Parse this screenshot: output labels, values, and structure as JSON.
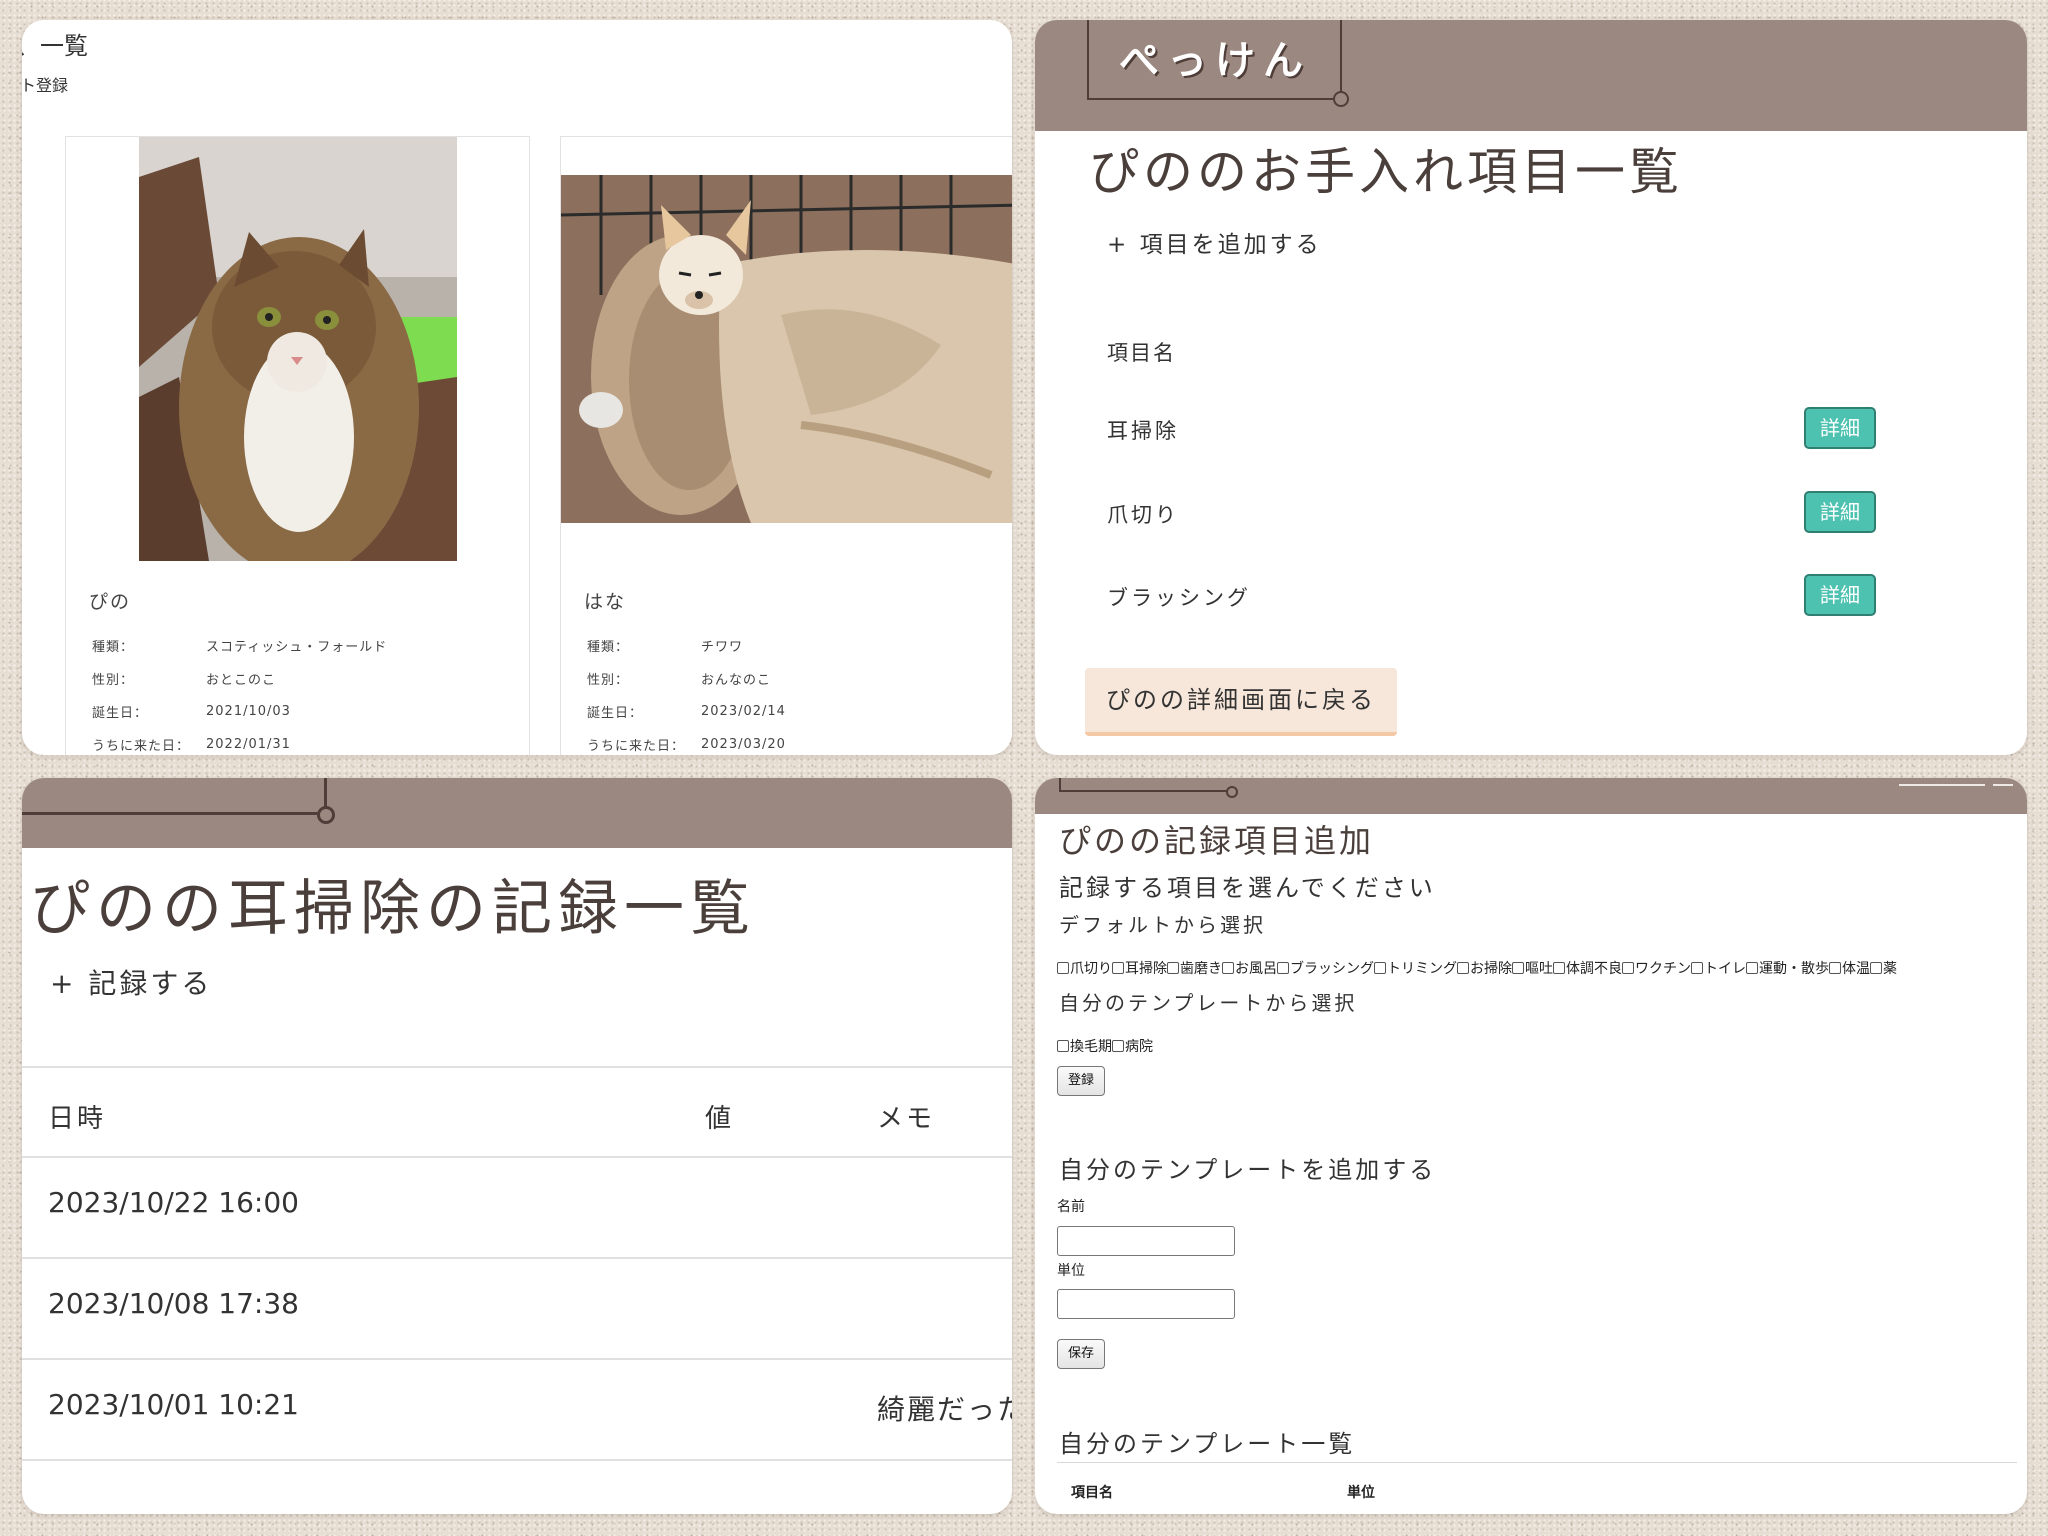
{
  "panel1": {
    "title": "、一覧",
    "register_link": "ト登録",
    "pets": [
      {
        "name": "ぴの",
        "photo": "cat-photo",
        "fields": [
          {
            "label": "種類：",
            "value": "スコティッシュ・フォールド"
          },
          {
            "label": "性別：",
            "value": "おとこのこ"
          },
          {
            "label": "誕生日：",
            "value": "2021/10/03"
          },
          {
            "label": "うちに来た日：",
            "value": "2022/01/31"
          }
        ]
      },
      {
        "name": "はな",
        "photo": "dog-photo",
        "fields": [
          {
            "label": "種類：",
            "value": "チワワ"
          },
          {
            "label": "性別：",
            "value": "おんなのこ"
          },
          {
            "label": "誕生日：",
            "value": "2023/02/14"
          },
          {
            "label": "うちに来た日：",
            "value": "2023/03/20"
          }
        ]
      }
    ]
  },
  "panel2": {
    "logo": "ぺっけん",
    "title": "ぴののお手入れ項目一覧",
    "add_link": "+ 項目を追加する",
    "column_header": "項目名",
    "items": [
      {
        "name": "耳掃除",
        "button": "詳細"
      },
      {
        "name": "爪切り",
        "button": "詳細"
      },
      {
        "name": "ブラッシング",
        "button": "詳細"
      }
    ],
    "back_button": "ぴのの詳細画面に戻る"
  },
  "panel3": {
    "title": "ぴのの耳掃除の記録一覧",
    "add_link": "+ 記録する",
    "columns": {
      "date": "日時",
      "value": "値",
      "memo": "メモ"
    },
    "rows": [
      {
        "date": "2023/10/22 16:00",
        "value": "",
        "memo": ""
      },
      {
        "date": "2023/10/08 17:38",
        "value": "",
        "memo": ""
      },
      {
        "date": "2023/10/01 10:21",
        "value": "",
        "memo": "綺麗だった"
      }
    ]
  },
  "panel4": {
    "title": "ぴのの記録項目追加",
    "choose_heading": "記録する項目を選んでください",
    "default_heading": "デフォルトから選択",
    "default_options": [
      "爪切り",
      "耳掃除",
      "歯磨き",
      "お風呂",
      "ブラッシング",
      "トリミング",
      "お掃除",
      "嘔吐",
      "体調不良",
      "ワクチン",
      "トイレ",
      "運動・散歩",
      "体温",
      "薬"
    ],
    "template_heading": "自分のテンプレートから選択",
    "template_options": [
      "換毛期",
      "病院"
    ],
    "register_button": "登録",
    "add_template_heading": "自分のテンプレートを追加する",
    "name_label": "名前",
    "unit_label": "単位",
    "save_button": "保存",
    "template_list_heading": "自分のテンプレート一覧",
    "template_list_columns": {
      "name": "項目名",
      "unit": "単位"
    }
  },
  "colors": {
    "header_brown": "#9b8880",
    "accent_teal": "#4ec2b0",
    "back_button_bg": "#f6e7da",
    "text_dark": "#4a3f3b"
  }
}
